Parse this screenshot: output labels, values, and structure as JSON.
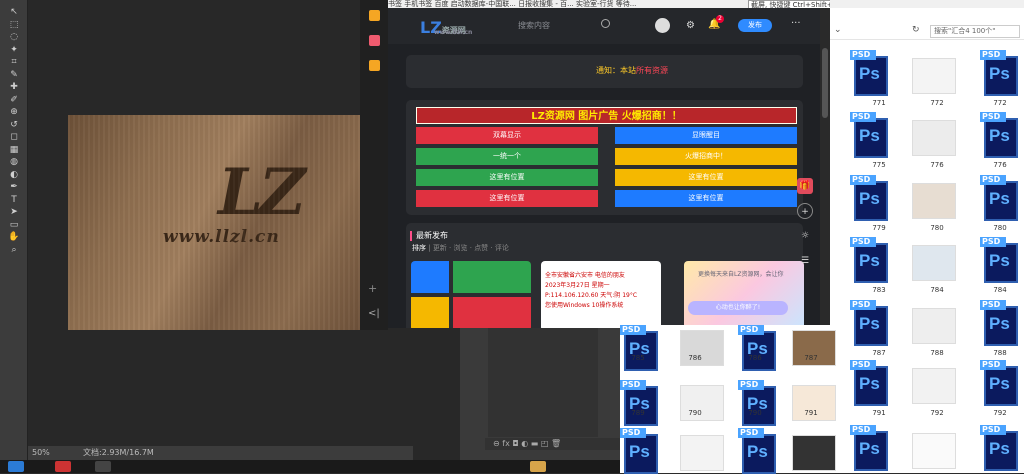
{
  "photoshop": {
    "zoom": "50%",
    "doc_info": "文档:2.93M/16.7M",
    "canvas_logo": "LZ",
    "canvas_url": "www.llzl.cn",
    "tools": [
      "move-tool",
      "marquee-tool",
      "lasso-tool",
      "magic-wand-tool",
      "crop-tool",
      "eyedropper-tool",
      "healing-tool",
      "brush-tool",
      "stamp-tool",
      "history-brush-tool",
      "eraser-tool",
      "gradient-tool",
      "blur-tool",
      "dodge-tool",
      "pen-tool",
      "type-tool",
      "path-select-tool",
      "shape-tool",
      "hand-tool",
      "zoom-tool"
    ]
  },
  "browser": {
    "bookmarks": "书签   手机书签   百度   启动数据库-中国联...   日报收搜集 - 百...   实验室-行货   等待...",
    "tooltip": "截屏, 快捷键 Ctrl+Shift+X"
  },
  "site": {
    "logo_text": "LZ",
    "logo_name": "资源网",
    "logo_sub": "www.llzl.cn",
    "search_placeholder": "搜索内容",
    "notification_count": "2",
    "publish_label": "发布",
    "notice_prefix": "通知：本站",
    "notice_highlight": "所有资源",
    "ad_banner": "LZ资源网   图片广告   火爆招商！！",
    "ad_buttons": [
      {
        "label": "双幕显示",
        "color": "#e03140"
      },
      {
        "label": "显眼醒目",
        "color": "#1e7bff"
      },
      {
        "label": "一统一个",
        "color": "#2ea44f"
      },
      {
        "label": "火爆招商中！",
        "color": "#f5b800"
      },
      {
        "label": "这里有位置",
        "color": "#2ea44f"
      },
      {
        "label": "这里有位置",
        "color": "#f5b800"
      },
      {
        "label": "这里有位置",
        "color": "#e03140"
      },
      {
        "label": "这里有位置",
        "color": "#1e7bff"
      }
    ],
    "latest_title": "最新发布",
    "sort_label": "排序",
    "sort_tabs": [
      "更新",
      "浏览",
      "点赞",
      "评论"
    ],
    "thumb2_lines": [
      "全市安徽省六安市 电信的朋友",
      "2023年3月27日 星期一",
      "P:114.106.120.60 天气:阴 19°C",
      "您使用Windows 10操作系统"
    ],
    "thumb3_text": "更换每天来自LZ资源网，会让你",
    "thumb3_btn": "心动也让你醉了!"
  },
  "explorer": {
    "search_placeholder": "搜索\"汇合4 100个\"",
    "rows": [
      [
        "771",
        "772",
        "772"
      ],
      [
        "775",
        "776",
        "776"
      ],
      [
        "779",
        "780",
        "780"
      ],
      [
        "783",
        "784",
        "784"
      ],
      [
        "787",
        "788",
        "788"
      ],
      [
        "791",
        "792",
        "792"
      ]
    ],
    "bottom_rows": [
      [
        "785",
        "786",
        "786",
        "787"
      ],
      [
        "789",
        "790",
        "790",
        "791"
      ]
    ]
  }
}
